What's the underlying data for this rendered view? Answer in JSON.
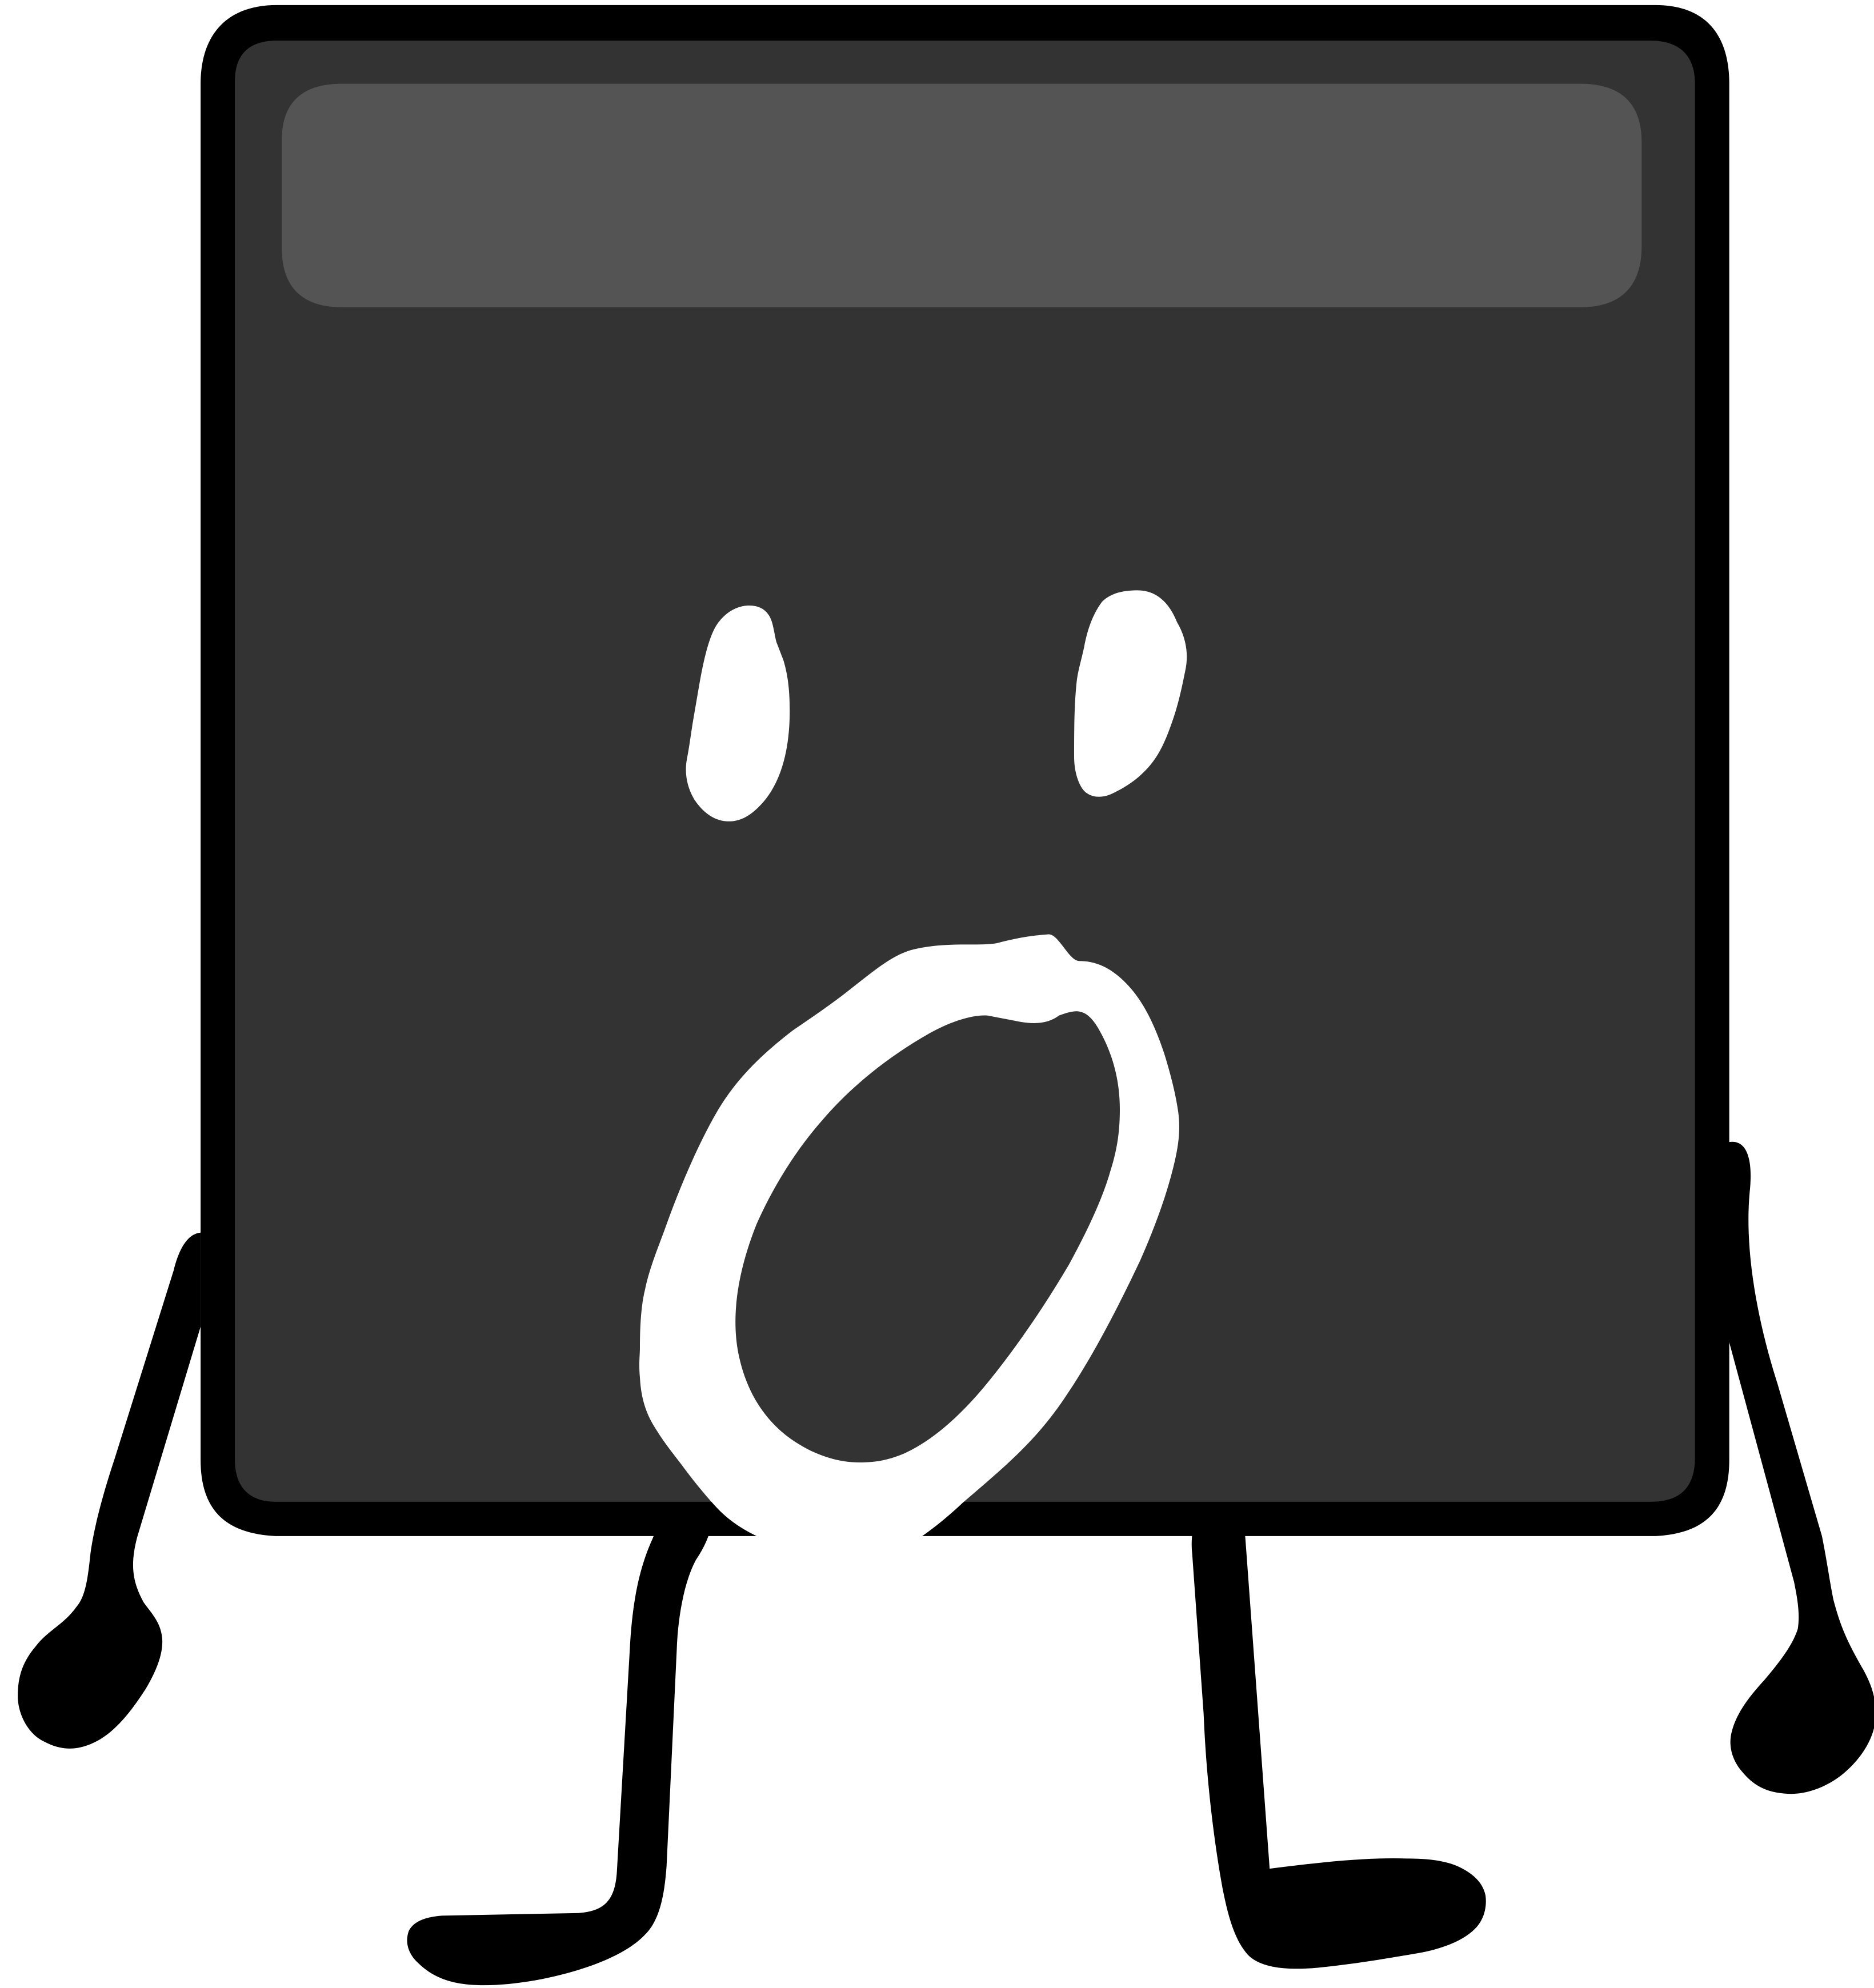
{
  "character": {
    "expression": "shocked",
    "colors": {
      "outline": "#000000",
      "body": "#333333",
      "highlight": "#545454",
      "face": "#ffffff",
      "background": "#ffffff"
    }
  }
}
